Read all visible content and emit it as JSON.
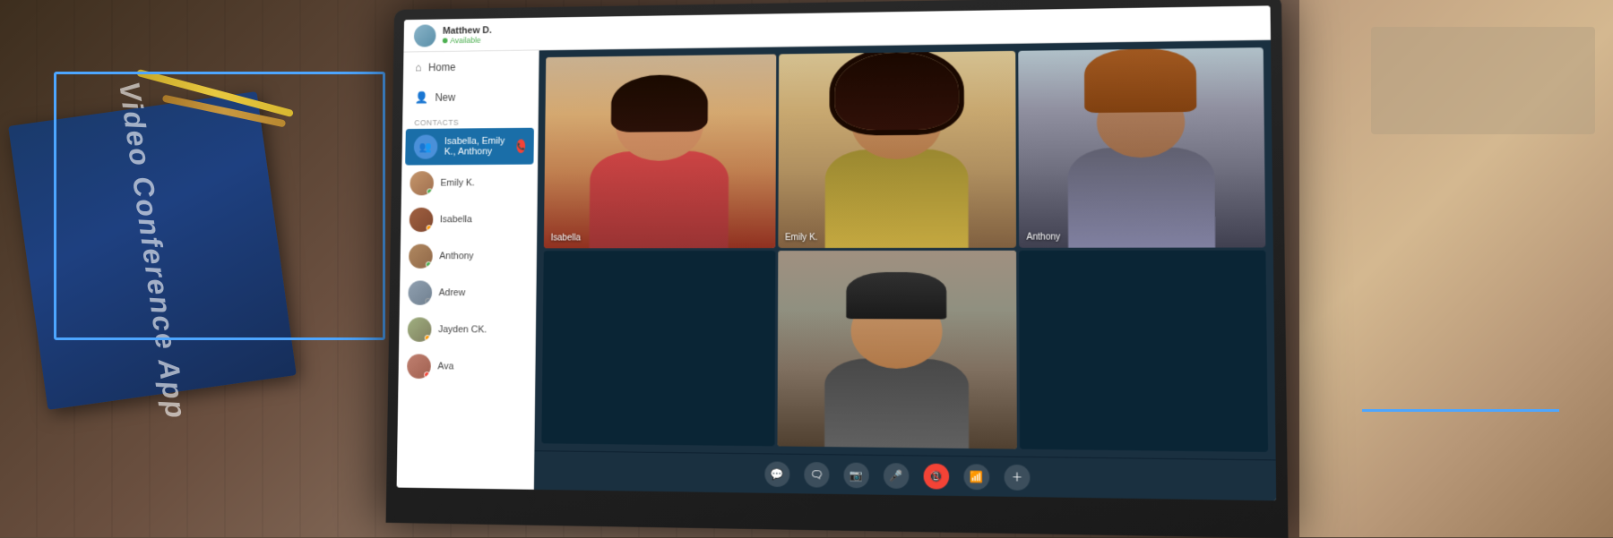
{
  "app": {
    "title": "Video Conference App"
  },
  "topbar": {
    "user_name": "Matthew D.",
    "user_status": "Available",
    "status_color": "#4caf50"
  },
  "sidebar": {
    "nav_items": [
      {
        "label": "Home",
        "icon": "🏠"
      },
      {
        "label": "New",
        "icon": "👤"
      }
    ],
    "contacts_label": "Contacts",
    "active_contact": "Isabella, Emily K., Anthony",
    "contacts": [
      {
        "name": "Emily K.",
        "status": "online",
        "avatar_class": "av-emily"
      },
      {
        "name": "Isabella",
        "status": "away",
        "avatar_class": "av-isabella"
      },
      {
        "name": "Anthony",
        "status": "online",
        "avatar_class": "av-anthony"
      },
      {
        "name": "Adrew",
        "status": "offline",
        "avatar_class": "av-adrew"
      },
      {
        "name": "Jayden CK.",
        "status": "away",
        "avatar_class": "av-jayden"
      },
      {
        "name": "Ava",
        "status": "busy",
        "avatar_class": "av-ava"
      }
    ]
  },
  "video": {
    "participants": [
      {
        "name": "Isabella",
        "position": "top-left"
      },
      {
        "name": "Emily K.",
        "position": "top-center"
      },
      {
        "name": "Anthony",
        "position": "top-right"
      },
      {
        "name": "",
        "position": "bottom-center"
      }
    ]
  },
  "controls": {
    "buttons": [
      {
        "icon": "💬",
        "label": "message",
        "type": "normal"
      },
      {
        "icon": "🗨",
        "label": "chat",
        "type": "normal"
      },
      {
        "icon": "📷",
        "label": "camera",
        "type": "normal"
      },
      {
        "icon": "🎤",
        "label": "microphone",
        "type": "normal"
      },
      {
        "icon": "📞",
        "label": "end-call",
        "type": "red"
      },
      {
        "icon": "📶",
        "label": "signal",
        "type": "normal"
      },
      {
        "icon": "➕",
        "label": "add",
        "type": "normal"
      }
    ]
  },
  "icons": {
    "home": "⌂",
    "new_user": "👤",
    "group": "👥",
    "phone_end": "📵",
    "camera": "📷",
    "mic": "🎤",
    "message": "💬",
    "chat": "🗨",
    "signal": "📶",
    "add": "＋",
    "dots": "•"
  }
}
